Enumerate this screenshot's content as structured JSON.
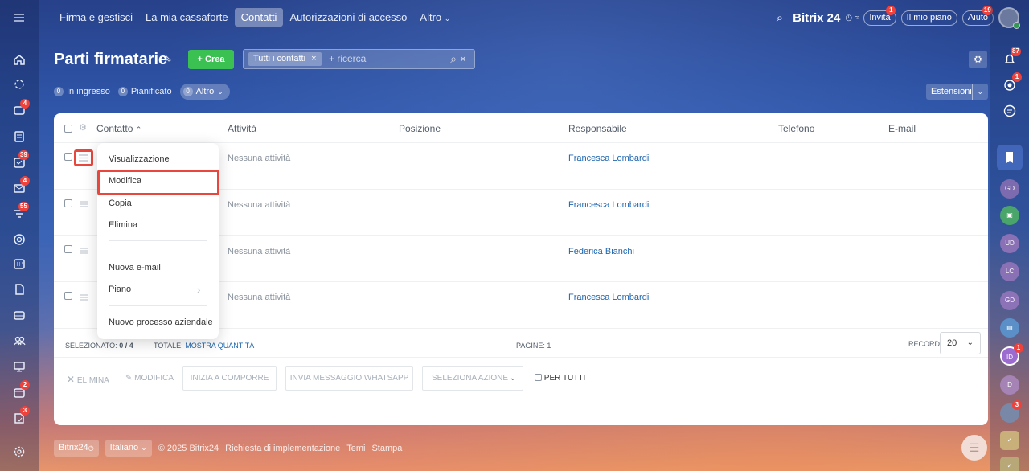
{
  "top_nav": {
    "items": [
      "Firma e gestisci",
      "La mia cassaforte",
      "Contatti",
      "Autorizzazioni di accesso",
      "Altro"
    ],
    "active_index": 2
  },
  "top_right": {
    "brand": "Bitrix 24",
    "invite_label": "Invita",
    "invite_badge": "1",
    "plan_label": "Il mio piano",
    "help_label": "Aiuto",
    "help_badge": "19"
  },
  "left_sidebar": {
    "badges": {
      "chat": "4",
      "tasks": "39",
      "mail": "4",
      "filters": "55",
      "calendar2": "2",
      "apps": "3"
    }
  },
  "header": {
    "title": "Parti firmatarie",
    "create_label": "+ Crea",
    "filter_chip": "Tutti i contatti",
    "search_placeholder": "+ ricerca",
    "counters": [
      {
        "count": "0",
        "label": "In ingresso"
      },
      {
        "count": "0",
        "label": "Pianificato"
      },
      {
        "count": "0",
        "label": "Altro"
      }
    ],
    "extensions_label": "Estensioni"
  },
  "table": {
    "columns": [
      "Contatto",
      "Attività",
      "Posizione",
      "Responsabile",
      "Telefono",
      "E-mail"
    ],
    "rows": [
      {
        "activity": "Nessuna attività",
        "responsible": "Francesca Lombardi"
      },
      {
        "activity": "Nessuna attività",
        "responsible": "Francesca Lombardi"
      },
      {
        "activity": "Nessuna attività",
        "responsible": "Federica Bianchi"
      },
      {
        "activity": "Nessuna attività",
        "responsible": "Francesca Lombardi"
      }
    ]
  },
  "footer": {
    "selected_label": "SELEZIONATO:",
    "selected_value": "0 / 4",
    "total_label": "TOTALE:",
    "total_link": "MOSTRA QUANTITÀ",
    "pages_label": "PAGINE: 1",
    "records_label": "RECORD:",
    "records_value": "20"
  },
  "actions": {
    "delete": "ELIMINA",
    "edit": "MODIFICA",
    "start_composing": "INIZIA A COMPORRE",
    "whatsapp": "INVIA MESSAGGIO WHATSAPP",
    "select_action": "SELEZIONA AZIONE",
    "for_all": "PER TUTTI"
  },
  "context_menu": {
    "items": [
      "Visualizzazione",
      "Modifica",
      "Copia",
      "Elimina",
      "Nuova e-mail",
      "Piano",
      "Nuovo processo aziendale"
    ],
    "highlighted": "Modifica"
  },
  "bottom_bar": {
    "brand": "Bitrix24",
    "language": "Italiano",
    "copyright": "© 2025 Bitrix24",
    "links": [
      "Richiesta di implementazione",
      "Temi",
      "Stampa"
    ]
  },
  "right_sidebar": {
    "notifications_badge": "87",
    "badge2": "1",
    "avatars": [
      "GD",
      "UD",
      "LC",
      "GD",
      "ID",
      "D"
    ],
    "id_badge": "1",
    "last_avatar_badge": "3"
  }
}
